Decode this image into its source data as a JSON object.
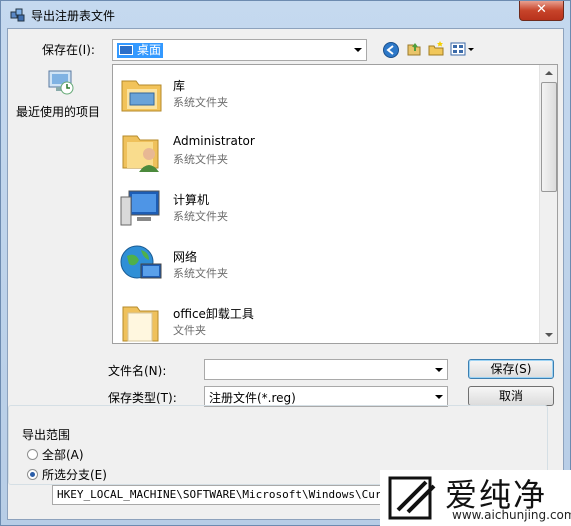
{
  "window": {
    "title": "导出注册表文件",
    "close_glyph": "✕"
  },
  "save_in": {
    "label": "保存在(I):",
    "value": "桌面"
  },
  "places": [
    {
      "label": "最近使用的项目",
      "icon": "recent-items-icon"
    }
  ],
  "files": [
    {
      "name": "库",
      "type": "系统文件夹",
      "icon": "library-icon"
    },
    {
      "name": "Administrator",
      "type": "系统文件夹",
      "icon": "user-folder-icon"
    },
    {
      "name": "计算机",
      "type": "系统文件夹",
      "icon": "computer-icon"
    },
    {
      "name": "网络",
      "type": "系统文件夹",
      "icon": "network-icon"
    },
    {
      "name": "office卸载工具",
      "type": "文件夹",
      "icon": "folder-icon"
    }
  ],
  "filename": {
    "label": "文件名(N):",
    "value": ""
  },
  "filetype": {
    "label": "保存类型(T):",
    "value": "注册文件(*.reg)"
  },
  "buttons": {
    "save": "保存(S)",
    "cancel": "取消"
  },
  "export_range": {
    "title": "导出范围",
    "all_label": "全部(A)",
    "selected_label": "所选分支(E)",
    "selected": "selected_branch",
    "branch_path": "HKEY_LOCAL_MACHINE\\SOFTWARE\\Microsoft\\Windows\\CurrentV"
  },
  "watermark": {
    "text": "爱纯净",
    "url": "www.aichunjing.com"
  }
}
